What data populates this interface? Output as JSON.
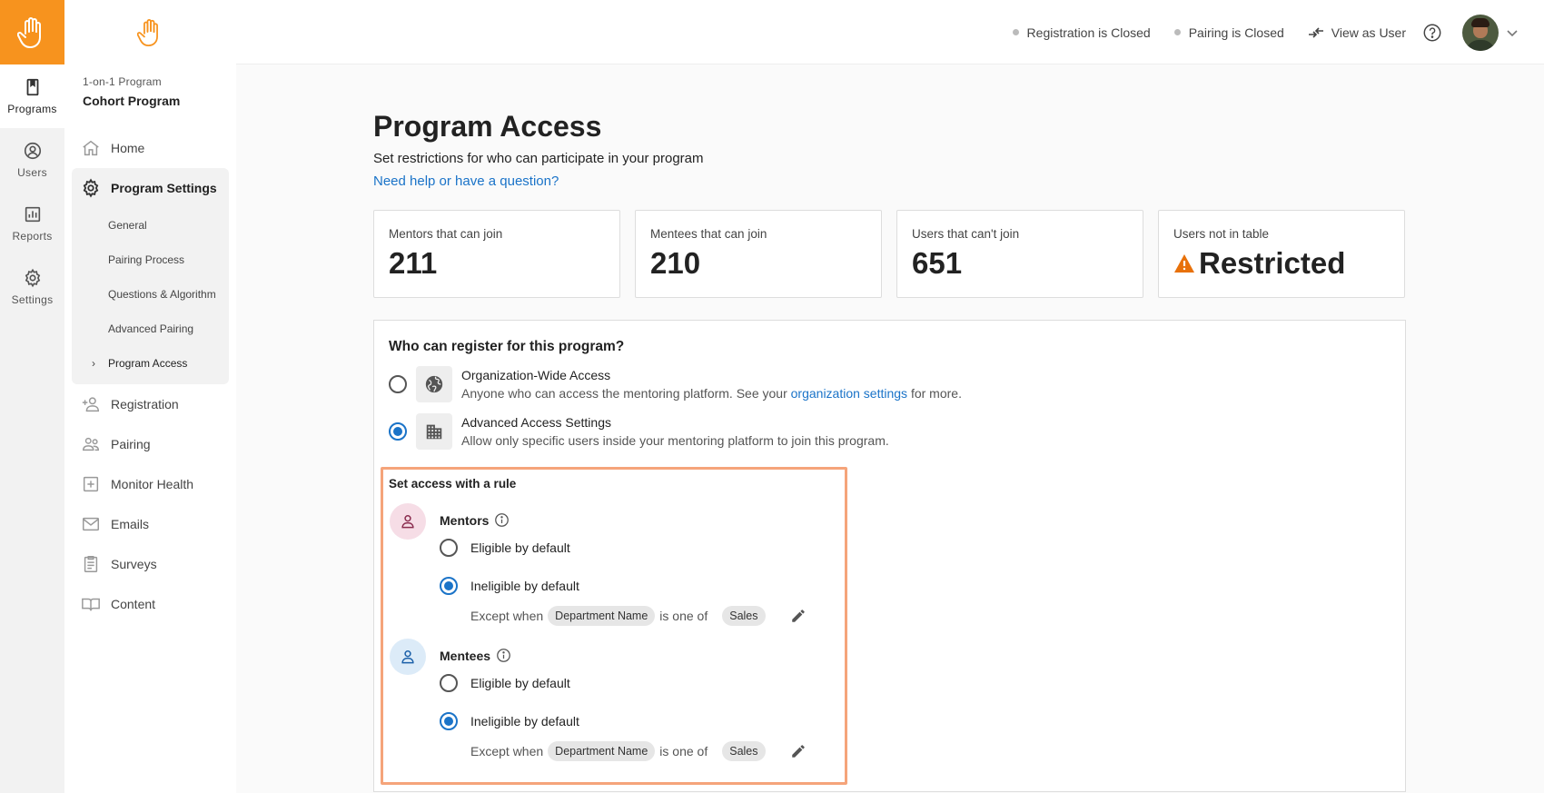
{
  "rail": {
    "items": [
      {
        "label": "Programs",
        "icon": "book-icon",
        "active": true
      },
      {
        "label": "Users",
        "icon": "user-circle-icon"
      },
      {
        "label": "Reports",
        "icon": "bar-chart-icon"
      },
      {
        "label": "Settings",
        "icon": "gear-icon"
      }
    ]
  },
  "sidebar": {
    "program_kind": "1-on-1 Program",
    "program_name": "Cohort Program",
    "nav": {
      "home": "Home",
      "program_settings": "Program Settings",
      "sub": [
        "General",
        "Pairing Process",
        "Questions & Algorithm",
        "Advanced Pairing",
        "Program Access"
      ],
      "registration": "Registration",
      "pairing": "Pairing",
      "monitor_health": "Monitor Health",
      "emails": "Emails",
      "surveys": "Surveys",
      "content": "Content"
    }
  },
  "header": {
    "registration_status": "Registration is Closed",
    "pairing_status": "Pairing is Closed",
    "view_as_user": "View as User"
  },
  "main": {
    "title": "Program Access",
    "subtitle": "Set restrictions for who can participate in your program",
    "help_link": "Need help or have a question?",
    "cards": [
      {
        "label": "Mentors that can join",
        "value": "211"
      },
      {
        "label": "Mentees that can join",
        "value": "210"
      },
      {
        "label": "Users that can't join",
        "value": "651"
      },
      {
        "label": "Users not in table",
        "value": "Restricted"
      }
    ],
    "panel": {
      "title": "Who can register for this program?",
      "org_wide": {
        "title": "Organization-Wide Access",
        "desc_before": "Anyone who can access the mentoring platform. See your",
        "desc_link": "organization settings",
        "desc_after": "for more."
      },
      "advanced": {
        "title": "Advanced Access Settings",
        "desc": "Allow only specific users inside your mentoring platform to join this program."
      },
      "rule": {
        "title": "Set access with a rule",
        "mentors": {
          "name": "Mentors",
          "eligible": "Eligible by default",
          "ineligible": "Ineligible by default",
          "except_when": "Except when",
          "field": "Department Name",
          "operator": "is one of",
          "value": "Sales"
        },
        "mentees": {
          "name": "Mentees",
          "eligible": "Eligible by default",
          "ineligible": "Ineligible by default",
          "except_when": "Except when",
          "field": "Department Name",
          "operator": "is one of",
          "value": "Sales"
        }
      }
    }
  },
  "colors": {
    "brand_orange": "#f7931e",
    "link_blue": "#1a73c8",
    "highlight_border": "#f5a47a",
    "warning": "#e8710a"
  }
}
